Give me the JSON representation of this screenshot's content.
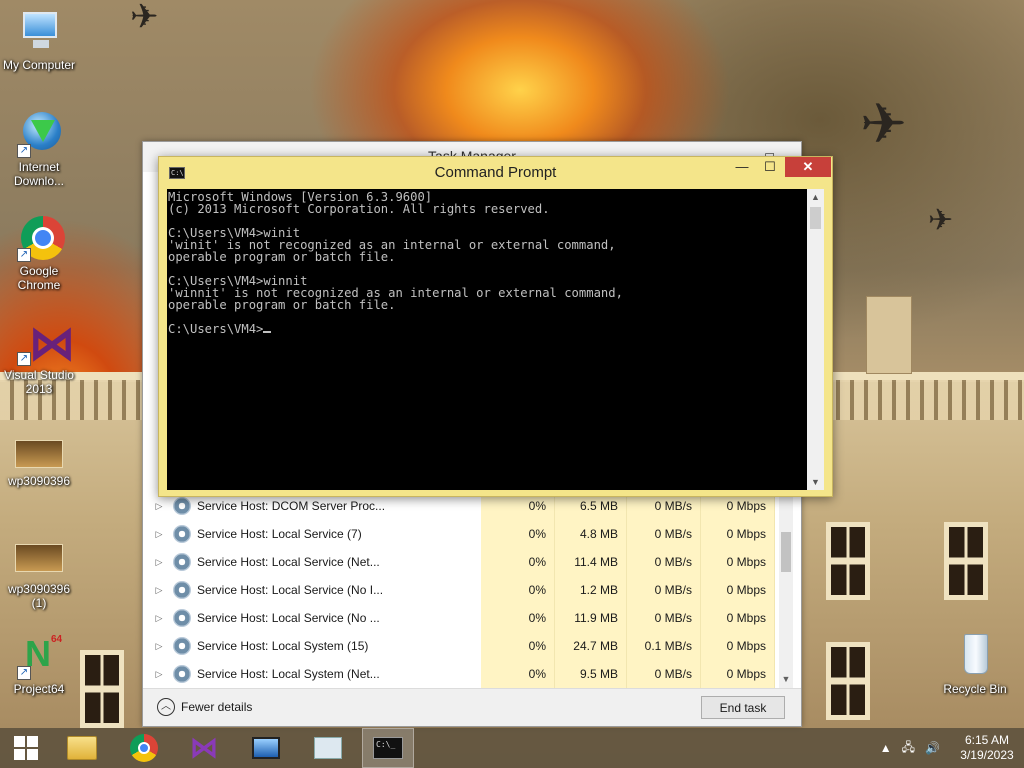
{
  "desktop": {
    "icons": [
      {
        "label": "My Computer"
      },
      {
        "label": "Internet Downlo..."
      },
      {
        "label": "Google Chrome"
      },
      {
        "label": "Visual Studio 2013"
      },
      {
        "label": "wp3090396"
      },
      {
        "label": "wp3090396 (1)"
      },
      {
        "label": "Project64"
      },
      {
        "label": "Recycle Bin"
      }
    ]
  },
  "task_manager": {
    "title": "Task Manager",
    "rows": [
      {
        "name": "Service Host: DCOM Server Proc...",
        "cpu": "0%",
        "memory": "6.5 MB",
        "disk": "0 MB/s",
        "network": "0 Mbps"
      },
      {
        "name": "Service Host: Local Service (7)",
        "cpu": "0%",
        "memory": "4.8 MB",
        "disk": "0 MB/s",
        "network": "0 Mbps"
      },
      {
        "name": "Service Host: Local Service (Net...",
        "cpu": "0%",
        "memory": "11.4 MB",
        "disk": "0 MB/s",
        "network": "0 Mbps"
      },
      {
        "name": "Service Host: Local Service (No I...",
        "cpu": "0%",
        "memory": "1.2 MB",
        "disk": "0 MB/s",
        "network": "0 Mbps"
      },
      {
        "name": "Service Host: Local Service (No ...",
        "cpu": "0%",
        "memory": "11.9 MB",
        "disk": "0 MB/s",
        "network": "0 Mbps"
      },
      {
        "name": "Service Host: Local System (15)",
        "cpu": "0%",
        "memory": "24.7 MB",
        "disk": "0.1 MB/s",
        "network": "0 Mbps"
      },
      {
        "name": "Service Host: Local System (Net...",
        "cpu": "0%",
        "memory": "9.5 MB",
        "disk": "0 MB/s",
        "network": "0 Mbps"
      }
    ],
    "fewer_details": "Fewer details",
    "end_task": "End task"
  },
  "command_prompt": {
    "title": "Command Prompt",
    "lines": [
      "Microsoft Windows [Version 6.3.9600]",
      "(c) 2013 Microsoft Corporation. All rights reserved.",
      "",
      "C:\\Users\\VM4>winit",
      "'winit' is not recognized as an internal or external command,",
      "operable program or batch file.",
      "",
      "C:\\Users\\VM4>winnit",
      "'winnit' is not recognized as an internal or external command,",
      "operable program or batch file.",
      ""
    ],
    "prompt": "C:\\Users\\VM4>"
  },
  "taskbar": {
    "clock_time": "6:15 AM",
    "clock_date": "3/19/2023",
    "items": [
      "start-icon",
      "file-explorer-icon",
      "chrome-icon",
      "visual-studio-icon",
      "computer-icon",
      "task-manager-icon",
      "command-prompt-icon"
    ]
  },
  "colors": {
    "cmd_frame": "#f4e58a",
    "close_button": "#c7403a",
    "tm_highlight": "#fff4c4",
    "console_bg": "#000000",
    "console_fg": "#c0c0c0"
  }
}
